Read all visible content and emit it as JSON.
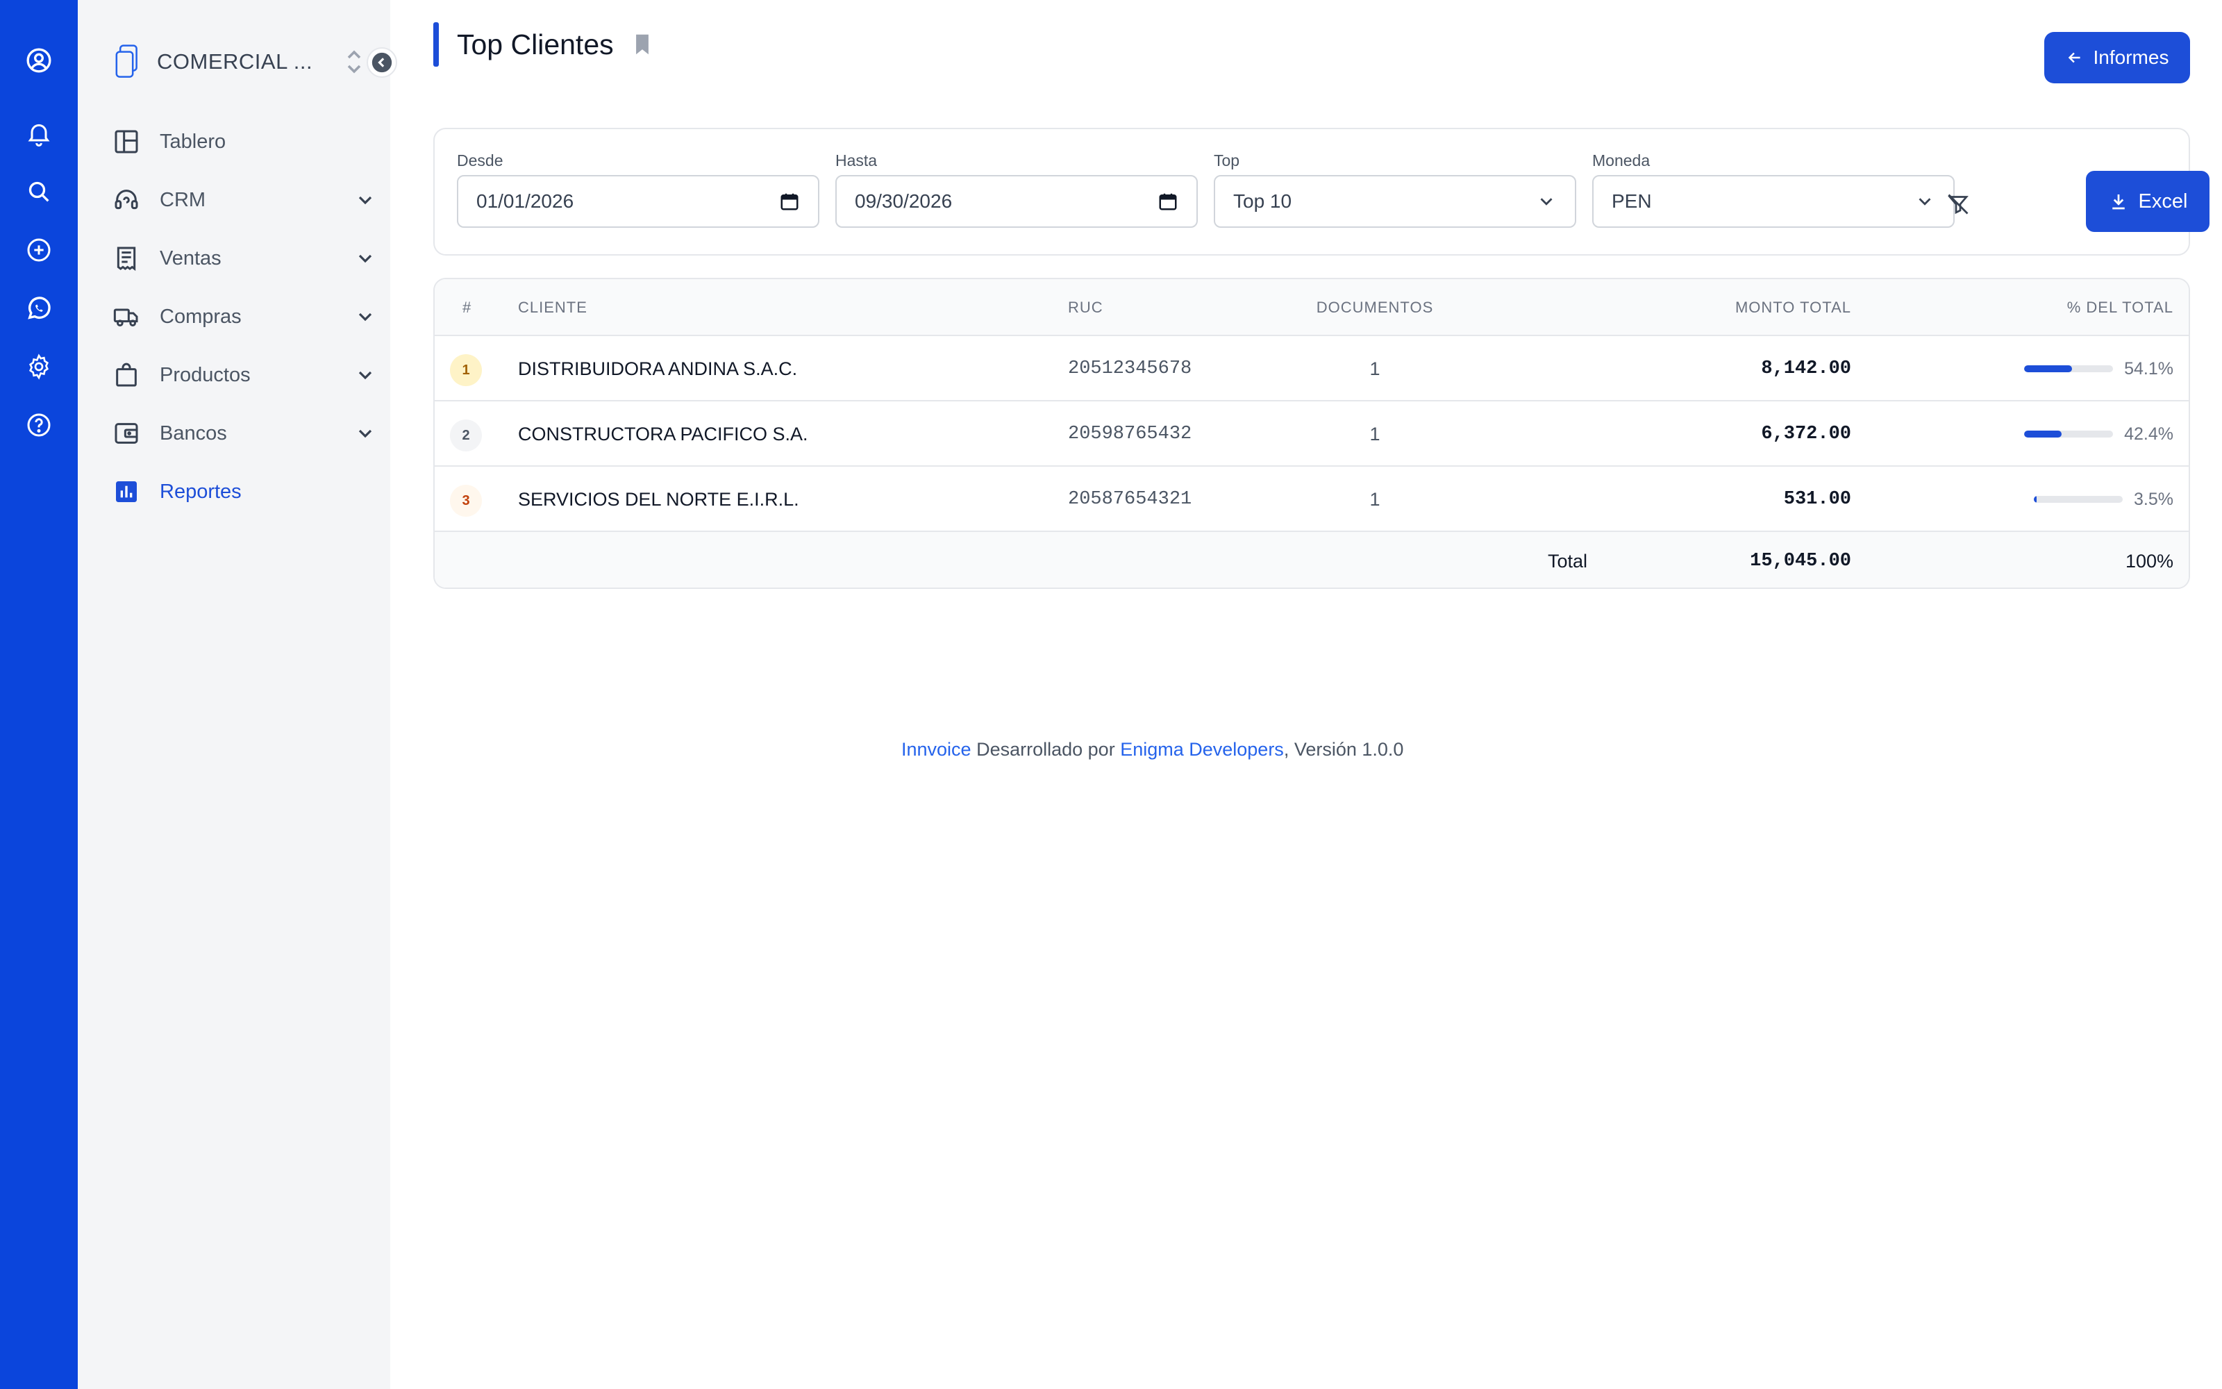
{
  "rail": {
    "icons": [
      "user-circle-icon",
      "bell-icon",
      "search-icon",
      "plus-circle-icon",
      "whatsapp-icon",
      "gear-icon",
      "help-icon"
    ]
  },
  "sidebar": {
    "company": "COMERCIAL ...",
    "items": [
      {
        "label": "Tablero",
        "icon": "dashboard-icon",
        "expandable": false
      },
      {
        "label": "CRM",
        "icon": "headset-icon",
        "expandable": true
      },
      {
        "label": "Ventas",
        "icon": "receipt-icon",
        "expandable": true
      },
      {
        "label": "Compras",
        "icon": "truck-icon",
        "expandable": true
      },
      {
        "label": "Productos",
        "icon": "shopping-bag-icon",
        "expandable": true
      },
      {
        "label": "Bancos",
        "icon": "wallet-icon",
        "expandable": true
      },
      {
        "label": "Reportes",
        "icon": "bar-chart-icon",
        "expandable": false,
        "active": true
      }
    ]
  },
  "header": {
    "title": "Top Clientes",
    "back_button": "Informes"
  },
  "filters": {
    "desde": {
      "label": "Desde",
      "value": "01/01/2026"
    },
    "hasta": {
      "label": "Hasta",
      "value": "09/30/2026"
    },
    "top": {
      "label": "Top",
      "value": "Top 10"
    },
    "moneda": {
      "label": "Moneda",
      "value": "PEN"
    },
    "excel_button": "Excel"
  },
  "table": {
    "columns": {
      "rank": "#",
      "cliente": "CLIENTE",
      "ruc": "RUC",
      "documentos": "DOCUMENTOS",
      "monto": "MONTO TOTAL",
      "pct": "% DEL TOTAL"
    },
    "rows": [
      {
        "rank": "1",
        "cliente": "DISTRIBUIDORA ANDINA S.A.C.",
        "ruc": "20512345678",
        "documentos": "1",
        "monto": "8,142.00",
        "pct": "54.1%",
        "pct_value": 54.1,
        "rank_bg": "#fef3c7",
        "rank_color": "#a16207"
      },
      {
        "rank": "2",
        "cliente": "CONSTRUCTORA PACIFICO S.A.",
        "ruc": "20598765432",
        "documentos": "1",
        "monto": "6,372.00",
        "pct": "42.4%",
        "pct_value": 42.4,
        "rank_bg": "#f3f4f6",
        "rank_color": "#4b5563"
      },
      {
        "rank": "3",
        "cliente": "SERVICIOS DEL NORTE E.I.R.L.",
        "ruc": "20587654321",
        "documentos": "1",
        "monto": "531.00",
        "pct": "3.5%",
        "pct_value": 3.5,
        "rank_bg": "#fff7ed",
        "rank_color": "#c2410c"
      }
    ],
    "footer": {
      "label": "Total",
      "monto": "15,045.00",
      "pct": "100%"
    }
  },
  "footer": {
    "brand": "Innvoice",
    "text": " Desarrollado por ",
    "developer": "Enigma Developers",
    "version": ", Versión 1.0.0"
  },
  "colors": {
    "accent": "#1d4ed8",
    "rail": "#0b45dc"
  }
}
